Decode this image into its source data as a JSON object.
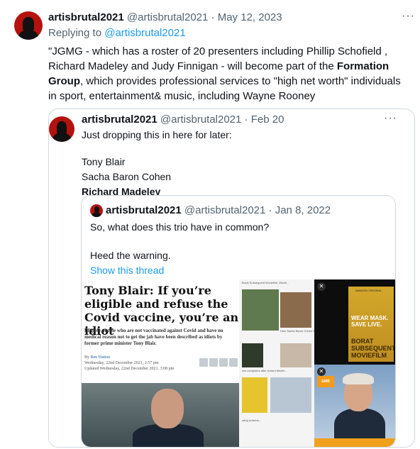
{
  "tweet": {
    "display_name": "artisbrutal2021",
    "handle": "@artisbrutal2021",
    "separator": "·",
    "date": "May 12, 2023",
    "replying_prefix": "Replying to",
    "replying_handle": "@artisbrutal2021",
    "more_icon": "more-horizontal-icon",
    "text_line1": "\"JGMG - which has a roster of 20 presenters including Phillip Schofield ,",
    "text_line2_pre": "Richard Madeley and Judy Finnigan - will become part of the",
    "text_line2_bold": "Formation",
    "text_line3_bold": "Group",
    "text_line3_post": ", which provides professional services to \"high net worth\"  individuals",
    "text_line4": "in sport, entertainment& music, including Wayne Rooney"
  },
  "quote1": {
    "display_name": "artisbrutal2021",
    "handle": "@artisbrutal2021",
    "separator": "·",
    "date": "Feb 20",
    "line1": "Just dropping this in here for later:",
    "line2": "Tony Blair",
    "line3": "Sacha Baron Cohen",
    "line4": "Richard Madeley"
  },
  "quote2": {
    "display_name": "artisbrutal2021",
    "handle": "@artisbrutal2021",
    "separator": "·",
    "date": "Jan 8, 2022",
    "line1": "So, what does this trio have in common?",
    "line2": "Heed the warning.",
    "show_thread": "Show this thread"
  },
  "media": {
    "article_title": "Tony Blair: If you’re eligible and refuse the Covid vaccine, you’re an idiot",
    "article_sub": "Eligible people who are not vaccinated against Covid and have no medical reason not to get the jab have been described as idiots by former prime minister Tony Blair.",
    "article_by_prefix": "By",
    "article_author": "Ben Hatton",
    "article_published": "Wednesday, 22nd December 2021, 2:57 pm",
    "article_updated": "Updated Wednesday, 22nd December 2021, 3:08 pm",
    "grid_caption1": "Borat Subsequent Moviefilm: Movie...",
    "grid_caption2": "How Sacha Baron Cohen Cl...",
    "grid_caption3": "ces complains after richard Madel...",
    "grid_caption4": "nting scheme...",
    "poster_brand": "AMAZON ORIGINAL",
    "poster_slogan": "WEAR MASK. SAVE LIVE.",
    "poster_title": "BORAT SUBSEQUENT MOVIEFILM",
    "tv_logo": "GMB",
    "close_icon": "close-icon",
    "colors": {
      "poster": "#c99a25",
      "tv_bar": "#f0a11c"
    }
  },
  "colors": {
    "link": "#1d9bf0",
    "muted": "#536471",
    "border": "#cfd9de",
    "avatar_bg": "#b3120f"
  }
}
